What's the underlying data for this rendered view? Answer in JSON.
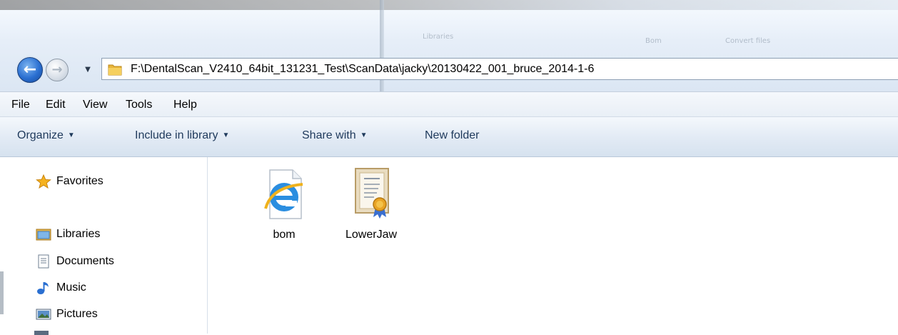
{
  "address": {
    "path": "F:\\DentalScan_V2410_64bit_131231_Test\\ScanData\\jacky\\20130422_001_bruce_2014-1-6"
  },
  "background_window": {
    "items": [
      "Libraries",
      "Bom",
      "Convert files"
    ]
  },
  "menu": {
    "items": [
      "File",
      "Edit",
      "View",
      "Tools",
      "Help"
    ]
  },
  "commands": {
    "organize": "Organize",
    "include_in_library": "Include in library",
    "share_with": "Share with",
    "new_folder": "New folder"
  },
  "navigation": {
    "favorites": "Favorites",
    "libraries": "Libraries",
    "documents": "Documents",
    "music": "Music",
    "pictures": "Pictures"
  },
  "files": [
    {
      "name": "bom",
      "icon": "internet-explorer-file-icon"
    },
    {
      "name": "LowerJaw",
      "icon": "certificate-file-icon"
    }
  ],
  "colors": {
    "command_text": "#1e395b",
    "accent": "#2a6fd1",
    "window_chrome": "#dbe6f3"
  }
}
